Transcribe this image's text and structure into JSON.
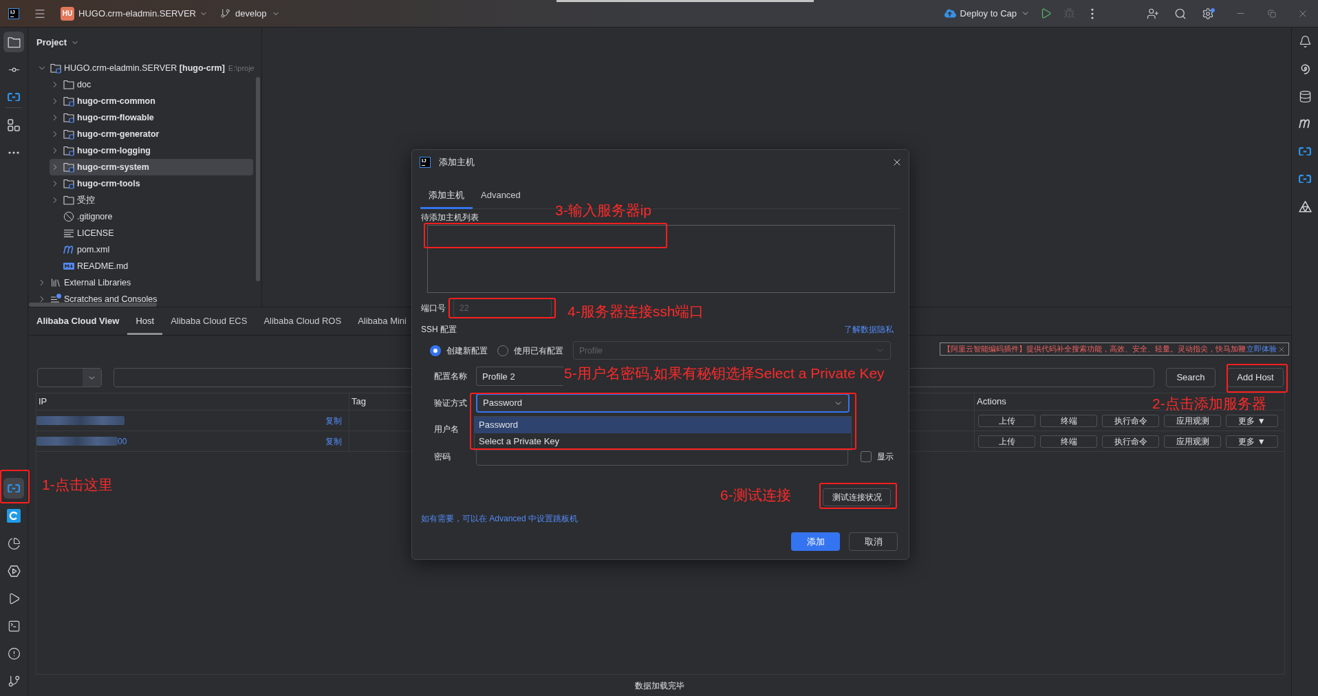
{
  "title_bar": {
    "logo": "IJ",
    "project_badge": "HU",
    "project": "HUGO.crm-eladmin.SERVER",
    "branch": "develop",
    "run_config": "Deploy to Cap",
    "debug": {
      "disabled": true
    },
    "settings": {
      "badge": true
    }
  },
  "left_toolbar": {
    "top": [
      {
        "selected": true
      },
      {
        "selected": false
      },
      {
        "selected": false
      },
      {
        "selected": false
      },
      {
        "selected": false
      }
    ],
    "bottom": [
      {
        "selected": true
      },
      {
        "selected": false
      },
      {
        "selected": false
      },
      {
        "selected": false
      },
      {
        "selected": false
      },
      {
        "selected": false
      },
      {
        "selected": false
      },
      {
        "selected": false
      }
    ]
  },
  "project_panel": {
    "title": "Project",
    "tree": [
      {
        "kind": "project",
        "label": "HUGO.crm-eladmin.SERVER **[hugo-crm]**",
        "path": "E:\\proje",
        "expanded": true,
        "selected": false,
        "children": [
          {
            "kind": "folder",
            "label": "doc",
            "expanded": false,
            "selected": false
          },
          {
            "kind": "module",
            "label": "hugo-crm-common",
            "expanded": false,
            "selected": false
          },
          {
            "kind": "module",
            "label": "hugo-crm-flowable",
            "expanded": false,
            "selected": false
          },
          {
            "kind": "module",
            "label": "hugo-crm-generator",
            "expanded": false,
            "selected": false
          },
          {
            "kind": "module",
            "label": "hugo-crm-logging",
            "expanded": false,
            "selected": false
          },
          {
            "kind": "module",
            "label": "hugo-crm-system",
            "expanded": false,
            "selected": true
          },
          {
            "kind": "module",
            "label": "hugo-crm-tools",
            "expanded": false,
            "selected": false
          },
          {
            "kind": "folder",
            "label": "受控",
            "expanded": false,
            "selected": false
          },
          {
            "kind": "ignore",
            "label": ".gitignore",
            "selected": false
          },
          {
            "kind": "text",
            "label": "LICENSE",
            "selected": false
          },
          {
            "kind": "maven",
            "label": "pom.xml",
            "selected": false
          },
          {
            "kind": "markdown",
            "label": "README.md",
            "selected": false
          }
        ]
      },
      {
        "kind": "libraries",
        "label": "External Libraries",
        "expanded": false,
        "selected": false
      },
      {
        "kind": "scratches",
        "label": "Scratches and Consoles",
        "expanded": false,
        "selected": false
      }
    ]
  },
  "bottom_panel": {
    "title": "Alibaba Cloud View",
    "tabs": [
      {
        "label": "Host",
        "selected": true
      },
      {
        "label": "Alibaba Cloud ECS",
        "selected": false
      },
      {
        "label": "Alibaba Cloud ROS",
        "selected": false
      },
      {
        "label": "Alibaba Mini",
        "selected": false
      }
    ],
    "notice": {
      "text": "【阿里云智能编码插件】提供代码补全搜索功能，高效、安全、轻量。灵动指尖，快马加鞭",
      "link": "立即体验"
    },
    "search_button": "Search",
    "add_host_button": "Add Host",
    "table": {
      "columns": [
        "IP",
        "Tag",
        "Actions"
      ],
      "rows": [
        {
          "copy": "复制",
          "actions": [
            "上传",
            "终端",
            "执行命令",
            "应用观测",
            "更多 ▼"
          ]
        },
        {
          "ip_tail": "00",
          "copy": "复制",
          "actions": [
            "上传",
            "终端",
            "执行命令",
            "应用观测",
            "更多 ▼"
          ]
        }
      ]
    },
    "status": "数据加载完毕"
  },
  "dialog": {
    "icon_text": "IJ",
    "title": "添加主机",
    "tabs": [
      {
        "label": "添加主机",
        "selected": true
      },
      {
        "label": "Advanced",
        "selected": false
      }
    ],
    "host_list": {
      "label": "待添加主机列表"
    },
    "port": {
      "label": "端口号",
      "placeholder": "22"
    },
    "ssh": {
      "label": "SSH 配置",
      "link": "了解数据隐私"
    },
    "config_options": [
      {
        "label": "创建新配置",
        "selected": true
      },
      {
        "label": "使用已有配置",
        "selected": false
      }
    ],
    "profile_select": {
      "value": "Profile",
      "disabled": true
    },
    "config_name": {
      "label": "配置名称",
      "value": "Profile 2"
    },
    "auth": {
      "label": "验证方式",
      "value": "Password",
      "expanded": true,
      "options": [
        {
          "label": "Password",
          "selected": true
        },
        {
          "label": "Select a Private Key",
          "selected": false
        }
      ]
    },
    "username": {
      "label": "用户名"
    },
    "password": {
      "label": "密码"
    },
    "show_password": {
      "label": "显示",
      "checked": false
    },
    "test_button": "测试连接状况",
    "hint": "如有需要，可以在 Advanced 中设置跳板机",
    "buttons": [
      {
        "label": "添加",
        "kind": "primary"
      },
      {
        "label": "取消",
        "kind": "secondary"
      }
    ]
  },
  "annotations": [
    "1-点击这里",
    "2-点击添加服务器",
    "3-输入服务器ip",
    "4-服务器连接ssh端口",
    "5-用户名密码,如果有秘钥选择Select a Private Key",
    "6-测试连接"
  ]
}
